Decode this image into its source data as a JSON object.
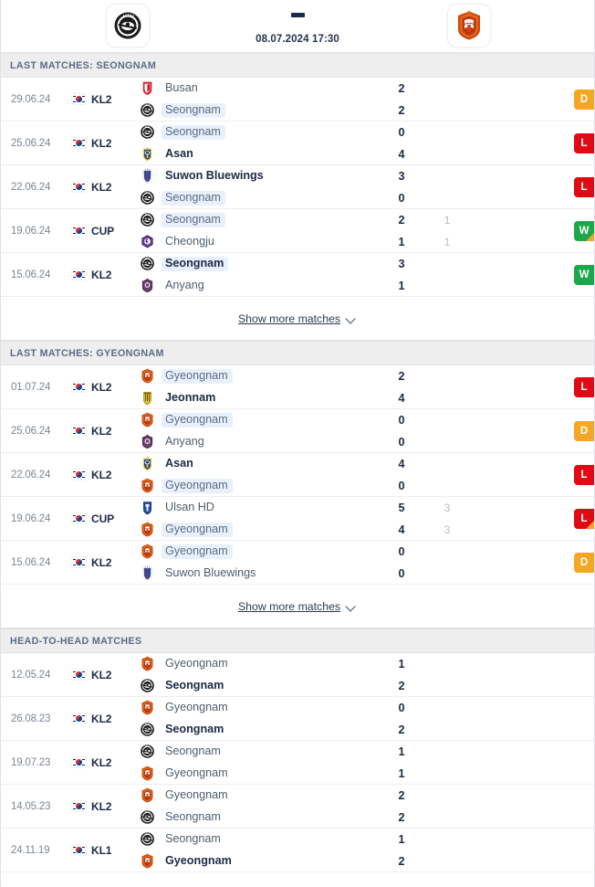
{
  "header": {
    "home_team": "Seongnam",
    "away_team": "Gyeongnam",
    "home_logo": "seongnam-crest",
    "away_logo": "gyeongnam-crest",
    "separator": "–",
    "kickoff": "08.07.2024 17:30"
  },
  "sections": [
    {
      "id": "last-matches-seongnam",
      "title": "LAST MATCHES: SEONGNAM",
      "show_more_label": "Show more matches",
      "matches": [
        {
          "date": "29.06.24",
          "league": "KL2",
          "country_flag": "south-korea-flag",
          "home": {
            "name": "Busan",
            "crest": "busan-crest",
            "bold": false,
            "highlight": false
          },
          "away": {
            "name": "Seongnam",
            "crest": "seongnam-crest",
            "bold": false,
            "highlight": true
          },
          "score_home": "2",
          "score_away": "2",
          "score2_home": "",
          "score2_away": "",
          "result": "D",
          "result_extra": false
        },
        {
          "date": "25.06.24",
          "league": "KL2",
          "country_flag": "south-korea-flag",
          "home": {
            "name": "Seongnam",
            "crest": "seongnam-crest",
            "bold": false,
            "highlight": true
          },
          "away": {
            "name": "Asan",
            "crest": "asan-crest",
            "bold": true,
            "highlight": false
          },
          "score_home": "0",
          "score_away": "4",
          "score2_home": "",
          "score2_away": "",
          "result": "L",
          "result_extra": false
        },
        {
          "date": "22.06.24",
          "league": "KL2",
          "country_flag": "south-korea-flag",
          "home": {
            "name": "Suwon Bluewings",
            "crest": "suwon-bluewings-crest",
            "bold": true,
            "highlight": false
          },
          "away": {
            "name": "Seongnam",
            "crest": "seongnam-crest",
            "bold": false,
            "highlight": true
          },
          "score_home": "3",
          "score_away": "0",
          "score2_home": "",
          "score2_away": "",
          "result": "L",
          "result_extra": false
        },
        {
          "date": "19.06.24",
          "league": "CUP",
          "country_flag": "south-korea-flag",
          "home": {
            "name": "Seongnam",
            "crest": "seongnam-crest",
            "bold": false,
            "highlight": true
          },
          "away": {
            "name": "Cheongju",
            "crest": "cheongju-crest",
            "bold": false,
            "highlight": false
          },
          "score_home": "2",
          "score_away": "1",
          "score2_home": "1",
          "score2_away": "1",
          "result": "W",
          "result_extra": true
        },
        {
          "date": "15.06.24",
          "league": "KL2",
          "country_flag": "south-korea-flag",
          "home": {
            "name": "Seongnam",
            "crest": "seongnam-crest",
            "bold": true,
            "highlight": true
          },
          "away": {
            "name": "Anyang",
            "crest": "anyang-crest",
            "bold": false,
            "highlight": false
          },
          "score_home": "3",
          "score_away": "1",
          "score2_home": "",
          "score2_away": "",
          "result": "W",
          "result_extra": false
        }
      ]
    },
    {
      "id": "last-matches-gyeongnam",
      "title": "LAST MATCHES: GYEONGNAM",
      "show_more_label": "Show more matches",
      "matches": [
        {
          "date": "01.07.24",
          "league": "KL2",
          "country_flag": "south-korea-flag",
          "home": {
            "name": "Gyeongnam",
            "crest": "gyeongnam-crest",
            "bold": false,
            "highlight": true
          },
          "away": {
            "name": "Jeonnam",
            "crest": "jeonnam-crest",
            "bold": true,
            "highlight": false
          },
          "score_home": "2",
          "score_away": "4",
          "score2_home": "",
          "score2_away": "",
          "result": "L",
          "result_extra": false
        },
        {
          "date": "25.06.24",
          "league": "KL2",
          "country_flag": "south-korea-flag",
          "home": {
            "name": "Gyeongnam",
            "crest": "gyeongnam-crest",
            "bold": false,
            "highlight": true
          },
          "away": {
            "name": "Anyang",
            "crest": "anyang-crest",
            "bold": false,
            "highlight": false
          },
          "score_home": "0",
          "score_away": "0",
          "score2_home": "",
          "score2_away": "",
          "result": "D",
          "result_extra": false
        },
        {
          "date": "22.06.24",
          "league": "KL2",
          "country_flag": "south-korea-flag",
          "home": {
            "name": "Asan",
            "crest": "asan-crest",
            "bold": true,
            "highlight": false
          },
          "away": {
            "name": "Gyeongnam",
            "crest": "gyeongnam-crest",
            "bold": false,
            "highlight": true
          },
          "score_home": "4",
          "score_away": "0",
          "score2_home": "",
          "score2_away": "",
          "result": "L",
          "result_extra": false
        },
        {
          "date": "19.06.24",
          "league": "CUP",
          "country_flag": "south-korea-flag",
          "home": {
            "name": "Ulsan HD",
            "crest": "ulsan-hd-crest",
            "bold": false,
            "highlight": false
          },
          "away": {
            "name": "Gyeongnam",
            "crest": "gyeongnam-crest",
            "bold": false,
            "highlight": true
          },
          "score_home": "5",
          "score_away": "4",
          "score2_home": "3",
          "score2_away": "3",
          "result": "L",
          "result_extra": true
        },
        {
          "date": "15.06.24",
          "league": "KL2",
          "country_flag": "south-korea-flag",
          "home": {
            "name": "Gyeongnam",
            "crest": "gyeongnam-crest",
            "bold": false,
            "highlight": true
          },
          "away": {
            "name": "Suwon Bluewings",
            "crest": "suwon-bluewings-crest",
            "bold": false,
            "highlight": false
          },
          "score_home": "0",
          "score_away": "0",
          "score2_home": "",
          "score2_away": "",
          "result": "D",
          "result_extra": false
        }
      ]
    },
    {
      "id": "head-to-head-matches",
      "title": "HEAD-TO-HEAD MATCHES",
      "show_more_label": "",
      "matches": [
        {
          "date": "12.05.24",
          "league": "KL2",
          "country_flag": "south-korea-flag",
          "home": {
            "name": "Gyeongnam",
            "crest": "gyeongnam-crest",
            "bold": false,
            "highlight": false
          },
          "away": {
            "name": "Seongnam",
            "crest": "seongnam-crest",
            "bold": true,
            "highlight": false
          },
          "score_home": "1",
          "score_away": "2",
          "score2_home": "",
          "score2_away": "",
          "result": "",
          "result_extra": false
        },
        {
          "date": "26.08.23",
          "league": "KL2",
          "country_flag": "south-korea-flag",
          "home": {
            "name": "Gyeongnam",
            "crest": "gyeongnam-crest",
            "bold": false,
            "highlight": false
          },
          "away": {
            "name": "Seongnam",
            "crest": "seongnam-crest",
            "bold": true,
            "highlight": false
          },
          "score_home": "0",
          "score_away": "2",
          "score2_home": "",
          "score2_away": "",
          "result": "",
          "result_extra": false
        },
        {
          "date": "19.07.23",
          "league": "KL2",
          "country_flag": "south-korea-flag",
          "home": {
            "name": "Seongnam",
            "crest": "seongnam-crest",
            "bold": false,
            "highlight": false
          },
          "away": {
            "name": "Gyeongnam",
            "crest": "gyeongnam-crest",
            "bold": false,
            "highlight": false
          },
          "score_home": "1",
          "score_away": "1",
          "score2_home": "",
          "score2_away": "",
          "result": "",
          "result_extra": false
        },
        {
          "date": "14.05.23",
          "league": "KL2",
          "country_flag": "south-korea-flag",
          "home": {
            "name": "Gyeongnam",
            "crest": "gyeongnam-crest",
            "bold": false,
            "highlight": false
          },
          "away": {
            "name": "Seongnam",
            "crest": "seongnam-crest",
            "bold": false,
            "highlight": false
          },
          "score_home": "2",
          "score_away": "2",
          "score2_home": "",
          "score2_away": "",
          "result": "",
          "result_extra": false
        },
        {
          "date": "24.11.19",
          "league": "KL1",
          "country_flag": "south-korea-flag",
          "home": {
            "name": "Seongnam",
            "crest": "seongnam-crest",
            "bold": false,
            "highlight": false
          },
          "away": {
            "name": "Gyeongnam",
            "crest": "gyeongnam-crest",
            "bold": true,
            "highlight": false
          },
          "score_home": "1",
          "score_away": "2",
          "score2_home": "",
          "score2_away": "",
          "result": "",
          "result_extra": false
        }
      ]
    }
  ],
  "colors": {
    "win": "#1aa84a",
    "loss": "#e00914",
    "draw": "#f5a623",
    "highlight": "#e8f1fb",
    "text_dark": "#1d2a44"
  }
}
